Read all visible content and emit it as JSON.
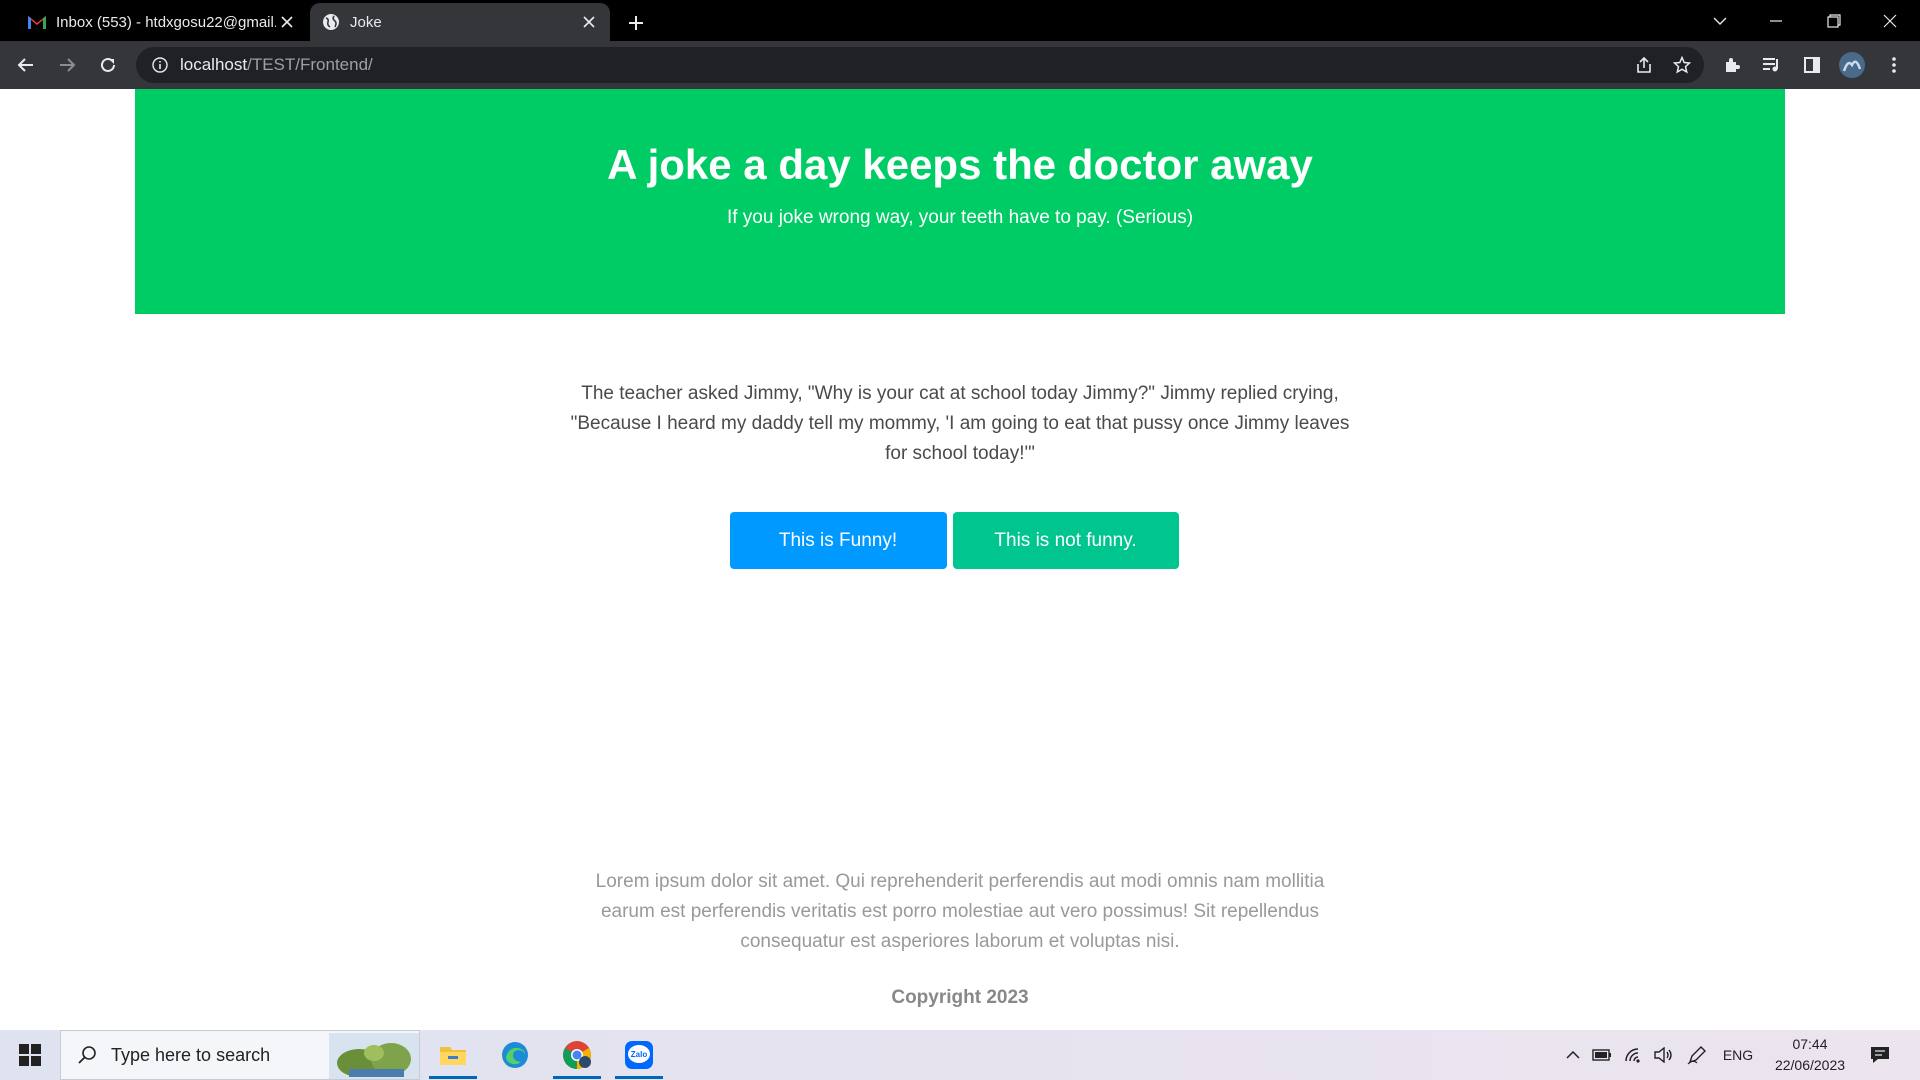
{
  "browser": {
    "tabs": [
      {
        "title": "Inbox (553) - htdxgosu22@gmail.com",
        "active": false,
        "icon": "gmail-icon"
      },
      {
        "title": "Joke",
        "active": true,
        "icon": "globe-icon"
      }
    ],
    "url": {
      "host": "localhost",
      "path": "/TEST/Frontend/"
    }
  },
  "page": {
    "hero": {
      "title": "A joke a day keeps the doctor away",
      "subtitle": "If you joke wrong way, your teeth have to pay. (Serious)"
    },
    "joke": {
      "text": "The teacher asked Jimmy, \"Why is your cat at school today Jimmy?\" Jimmy replied crying, \"Because I heard my daddy tell my mommy, 'I am going to eat that pussy once Jimmy leaves for school today!'\""
    },
    "buttons": {
      "funny": "This is Funny!",
      "not_funny": "This is not funny."
    },
    "footer": {
      "text": "Lorem ipsum dolor sit amet. Qui reprehenderit perferendis aut modi omnis nam mollitia earum est perferendis veritatis est porro molestiae aut vero possimus! Sit repellendus consequatur est asperiores laborum et voluptas nisi.",
      "copyright": "Copyright 2023"
    }
  },
  "taskbar": {
    "search_placeholder": "Type here to search",
    "language": "ENG",
    "time": "07:44",
    "date": "22/06/2023"
  },
  "colors": {
    "hero_bg": "#00cc66",
    "funny_button": "#0099ff",
    "not_funny_button": "#00c58e"
  }
}
